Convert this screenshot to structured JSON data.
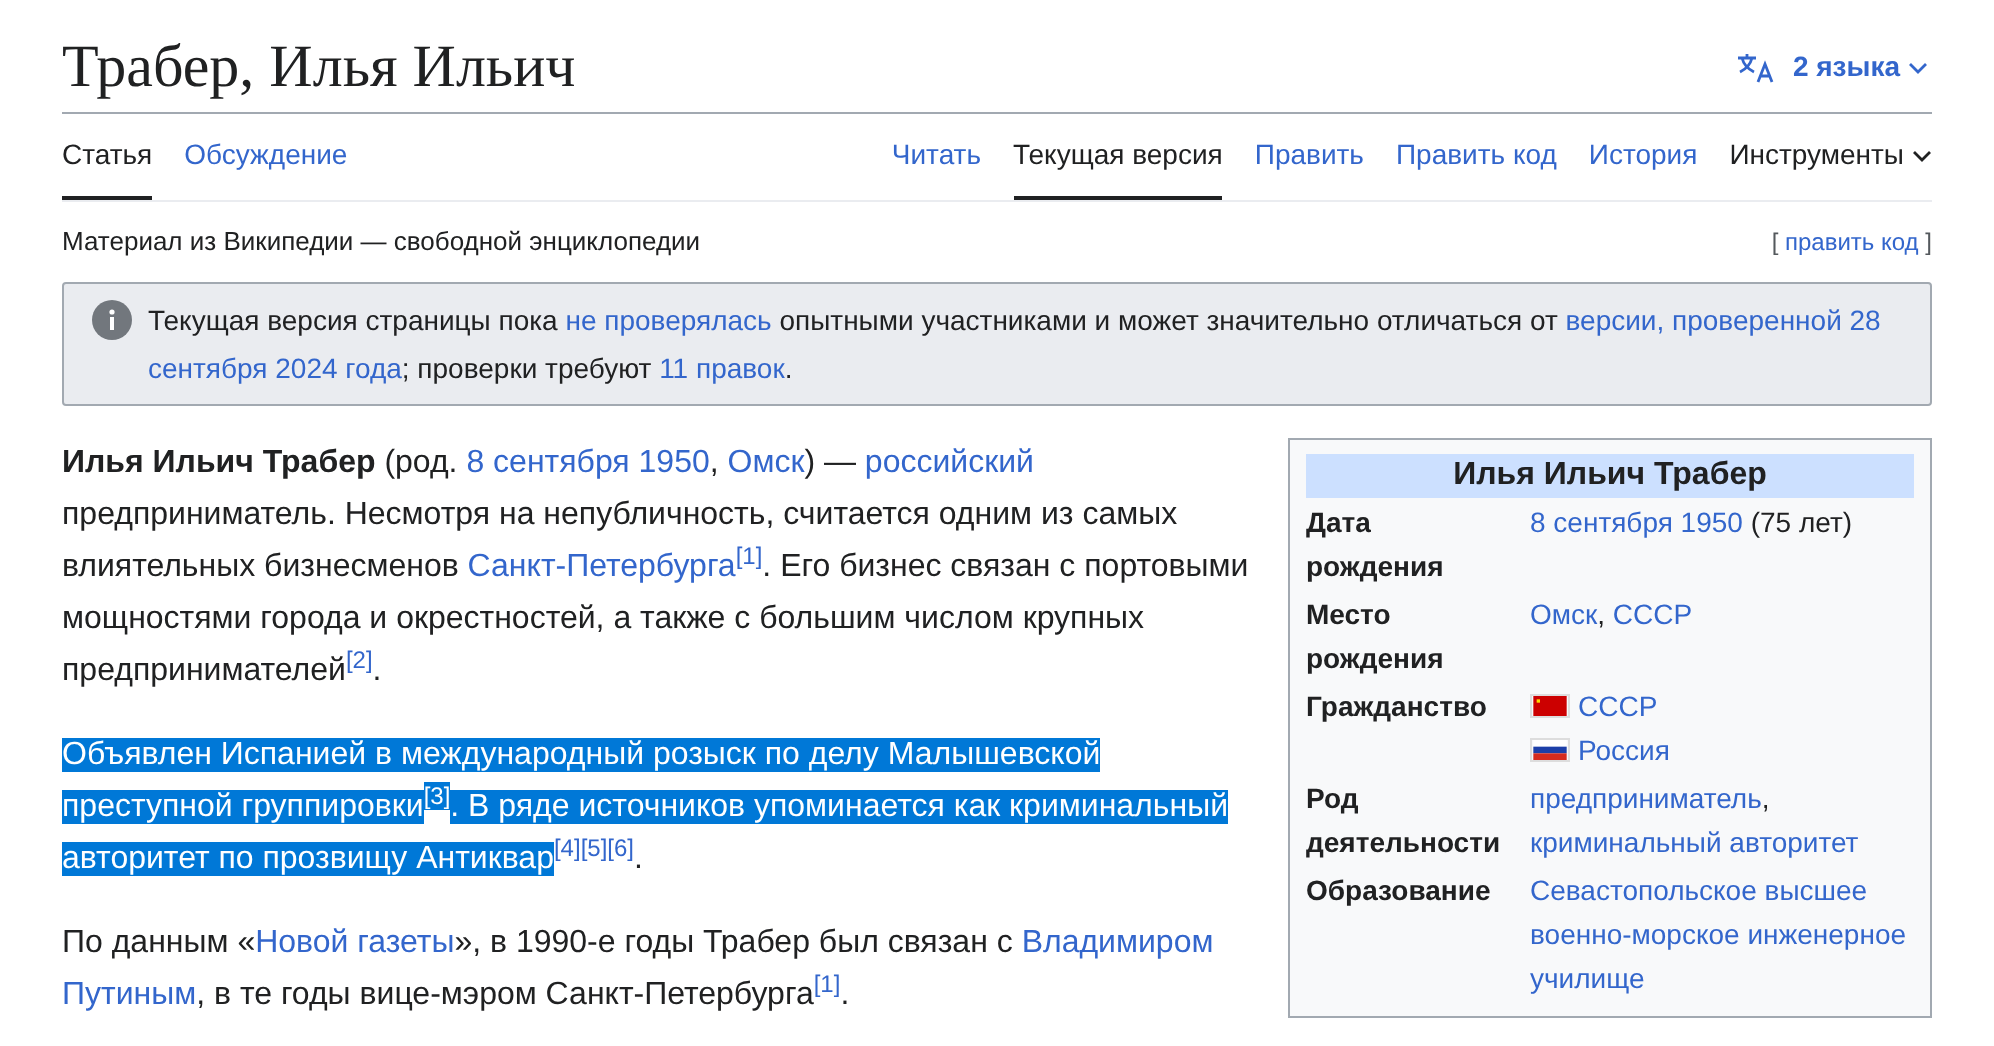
{
  "title": "Трабер, Илья Ильич",
  "language_button": {
    "label": "2 языка"
  },
  "left_tabs": [
    {
      "label": "Статья",
      "selected": true
    },
    {
      "label": "Обсуждение",
      "selected": false
    }
  ],
  "right_tabs": [
    {
      "label": "Читать",
      "selected": false,
      "kind": "link"
    },
    {
      "label": "Текущая версия",
      "selected": true,
      "kind": "link"
    },
    {
      "label": "Править",
      "selected": false,
      "kind": "link"
    },
    {
      "label": "Править код",
      "selected": false,
      "kind": "link"
    },
    {
      "label": "История",
      "selected": false,
      "kind": "link"
    },
    {
      "label": "Инструменты",
      "selected": false,
      "kind": "dropdown"
    }
  ],
  "tagline": "Материал из Википедии — свободной энциклопедии",
  "edit_link": {
    "open": "[",
    "label": "править код",
    "close": "]"
  },
  "notice": [
    {
      "kind": "text",
      "text": "Текущая версия страницы пока "
    },
    {
      "kind": "link",
      "text": "не проверялась"
    },
    {
      "kind": "text",
      "text": " опытными участниками и может значительно отличаться от "
    },
    {
      "kind": "link",
      "text": "версии, проверенной 28"
    },
    {
      "kind": "link",
      "text": "сентября 2024 года"
    },
    {
      "kind": "text",
      "text": "; проверки требуют "
    },
    {
      "kind": "link",
      "text": "11 правок"
    },
    {
      "kind": "text",
      "text": "."
    }
  ],
  "paragraphs": [
    [
      {
        "kind": "bold",
        "text": "Илья Ильич Трабер"
      },
      {
        "kind": "text",
        "text": " (род. "
      },
      {
        "kind": "link",
        "text": "8 сентября 1950"
      },
      {
        "kind": "text",
        "text": ", "
      },
      {
        "kind": "link",
        "text": "Омск"
      },
      {
        "kind": "text",
        "text": ") — "
      },
      {
        "kind": "link",
        "text": "российский"
      },
      {
        "kind": "text",
        "text": " предприниматель. Несмотря на непубличность, считается одним из самых влиятельных бизнесменов "
      },
      {
        "kind": "link",
        "text": "Санкт-Петербурга"
      },
      {
        "kind": "ref",
        "text": "[1]"
      },
      {
        "kind": "text",
        "text": ". Его бизнес связан с портовыми мощностями города и окрестностей, а также с большим числом крупных предпринимателей"
      },
      {
        "kind": "ref",
        "text": "[2]"
      },
      {
        "kind": "text",
        "text": "."
      }
    ],
    [
      {
        "kind": "text",
        "text": "Объявлен Испанией в международный розыск по делу Малышевской преступной группировки",
        "selected": true
      },
      {
        "kind": "ref",
        "text": "[3]",
        "selected": true
      },
      {
        "kind": "text",
        "text": ". В ряде источников упоминается как криминальный авторитет по прозвищу Антиквар",
        "selected": true
      },
      {
        "kind": "ref",
        "text": "[4]",
        "selected": false
      },
      {
        "kind": "ref",
        "text": "[5]",
        "selected": false
      },
      {
        "kind": "ref",
        "text": "[6]",
        "selected": false
      },
      {
        "kind": "text",
        "text": ".",
        "selected": false
      }
    ],
    [
      {
        "kind": "text",
        "text": "По данным «"
      },
      {
        "kind": "link",
        "text": "Новой газеты"
      },
      {
        "kind": "text",
        "text": "», в 1990-е годы Трабер был связан с "
      },
      {
        "kind": "link",
        "text": "Владимиром"
      },
      {
        "kind": "link",
        "text": "Путиным"
      },
      {
        "kind": "text",
        "text": ", в те годы вице-мэром Санкт-Петербурга"
      },
      {
        "kind": "ref",
        "text": "[1]"
      },
      {
        "kind": "text",
        "text": "."
      }
    ]
  ],
  "infobox": {
    "title": "Илья Ильич Трабер",
    "rows": [
      {
        "label": "Дата рождения",
        "kind": "inline",
        "values": [
          {
            "kind": "link",
            "text": "8 сентября 1950"
          },
          {
            "kind": "text",
            "text": " (75 лет)"
          }
        ]
      },
      {
        "label": "Место рождения",
        "kind": "inline",
        "values": [
          {
            "kind": "link",
            "text": "Омск"
          },
          {
            "kind": "text",
            "text": ", "
          },
          {
            "kind": "link",
            "text": "СССР"
          }
        ]
      },
      {
        "label": "Гражданство",
        "kind": "flags",
        "values": [
          {
            "kind": "link",
            "text": "СССР"
          },
          {
            "kind": "link",
            "text": "Россия"
          }
        ]
      },
      {
        "label": "Род деятельности",
        "kind": "lines",
        "lines": [
          [
            {
              "kind": "link",
              "text": "предприниматель"
            },
            {
              "kind": "text",
              "text": ","
            }
          ],
          [
            {
              "kind": "link",
              "text": "криминальный авторитет"
            }
          ]
        ]
      },
      {
        "label": "Образование",
        "kind": "inline",
        "values": [
          {
            "kind": "link",
            "text": "Севастопольское высшее военно-морское инженерное училище"
          }
        ]
      }
    ]
  }
}
